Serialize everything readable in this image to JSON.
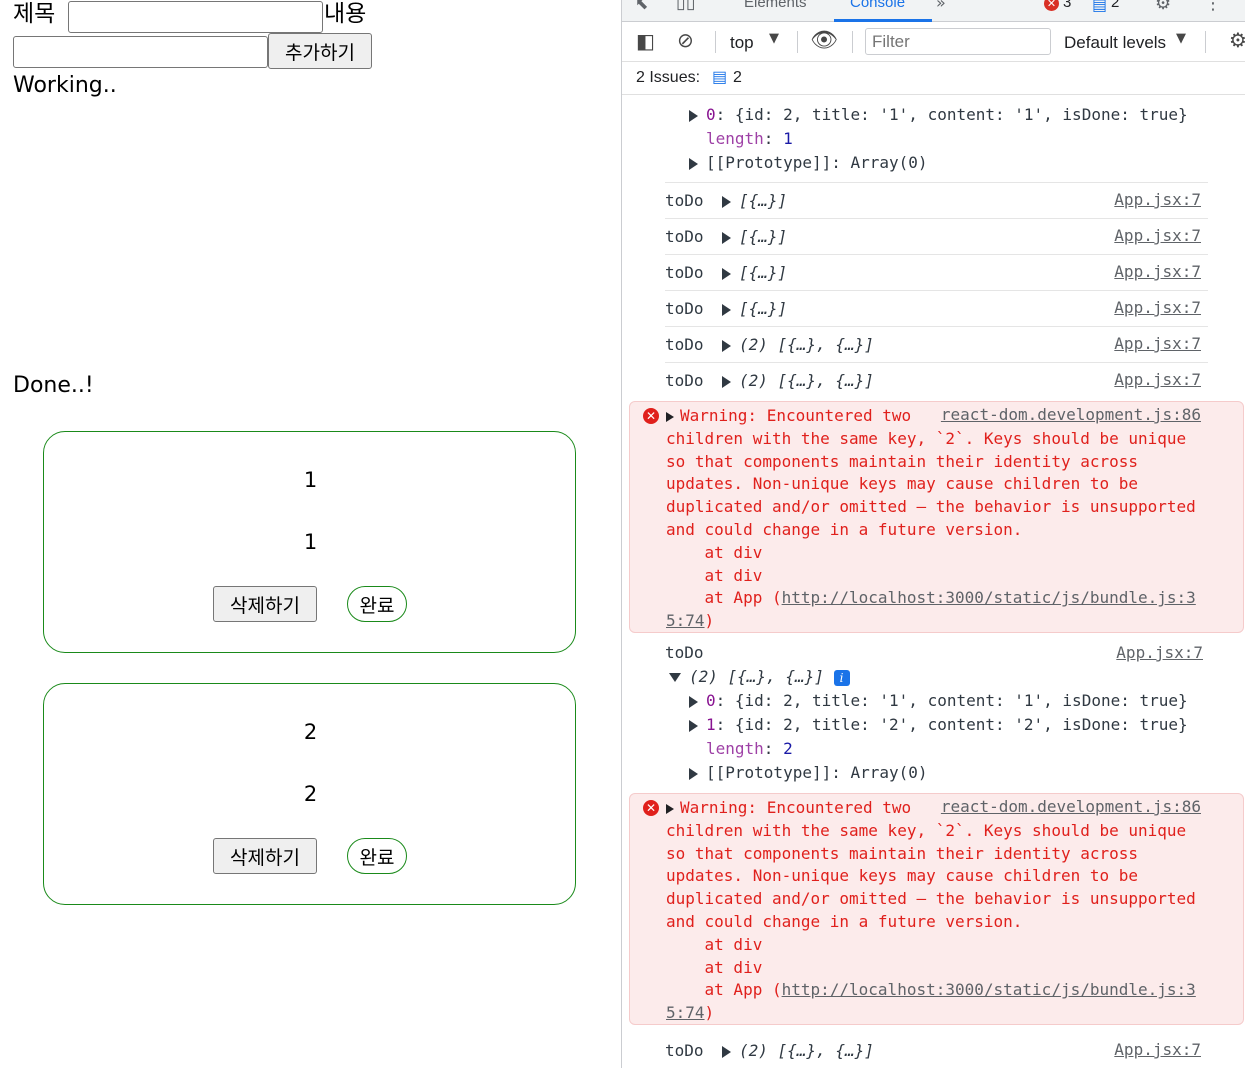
{
  "app": {
    "title_label": "제목",
    "content_label": "내용",
    "title_input_value": "",
    "content_input_value": "",
    "add_button": "추가하기",
    "working_heading": "Working..",
    "done_heading": "Done..!",
    "done_cards": [
      {
        "title": "1",
        "content": "1",
        "delete_label": "삭제하기",
        "done_label": "완료"
      },
      {
        "title": "2",
        "content": "2",
        "delete_label": "삭제하기",
        "done_label": "완료"
      }
    ]
  },
  "devtools": {
    "tabs": [
      "Elements",
      "Console"
    ],
    "active_tab": "Console",
    "error_count": "3",
    "message_count": "2",
    "context": "top",
    "filter_placeholder": "Filter",
    "levels": "Default levels",
    "issues_label": "2 Issues:",
    "issues_count": "2",
    "colors": {
      "accent": "#1a73e8",
      "error": "#e0201c",
      "error_bg": "#fcebeb",
      "done_green": "#1a8a1a"
    },
    "icons": [
      "inspect-icon",
      "device-icon",
      "more-tabs-icon",
      "gear-icon",
      "kebab-icon",
      "sidebar-icon",
      "clear-icon",
      "eye-icon"
    ],
    "top_object": {
      "item0": "{id: 2, title: '1', content: '1', isDone: true}",
      "length": "1",
      "prototype": "Array(0)"
    },
    "log_rows": [
      {
        "name": "toDo",
        "preview": "[{…}]",
        "src": "App.jsx:7"
      },
      {
        "name": "toDo",
        "preview": "[{…}]",
        "src": "App.jsx:7"
      },
      {
        "name": "toDo",
        "preview": "[{…}]",
        "src": "App.jsx:7"
      },
      {
        "name": "toDo",
        "preview": "[{…}]",
        "src": "App.jsx:7"
      },
      {
        "name": "toDo",
        "preview": "(2) [{…}, {…}]",
        "src": "App.jsx:7"
      },
      {
        "name": "toDo",
        "preview": "(2) [{…}, {…}]",
        "src": "App.jsx:7"
      }
    ],
    "warning": {
      "src": "react-dom.development.js:86",
      "first_line": "Warning: Encountered two",
      "lines": [
        "children with the same key, `2`. Keys should be unique",
        "so that components maintain their identity across",
        "updates. Non-unique keys may cause children to be",
        "duplicated and/or omitted — the behavior is unsupported",
        "and could change in a future version.",
        "    at div",
        "    at div"
      ],
      "at_app": "    at App (",
      "url": "http://localhost:3000/static/js/bundle.js:3",
      "url_tail": "5:74",
      "close_paren": ")"
    },
    "expanded": {
      "name": "toDo",
      "src": "App.jsx:7",
      "preview": "(2) [{…}, {…}]",
      "item0": "{id: 2, title: '1', content: '1', isDone: true}",
      "item1": "{id: 2, title: '2', content: '2', isDone: true}",
      "length": "2",
      "prototype": "Array(0)"
    },
    "last_row": {
      "name": "toDo",
      "preview": "(2) [{…}, {…}]",
      "src": "App.jsx:7"
    }
  }
}
